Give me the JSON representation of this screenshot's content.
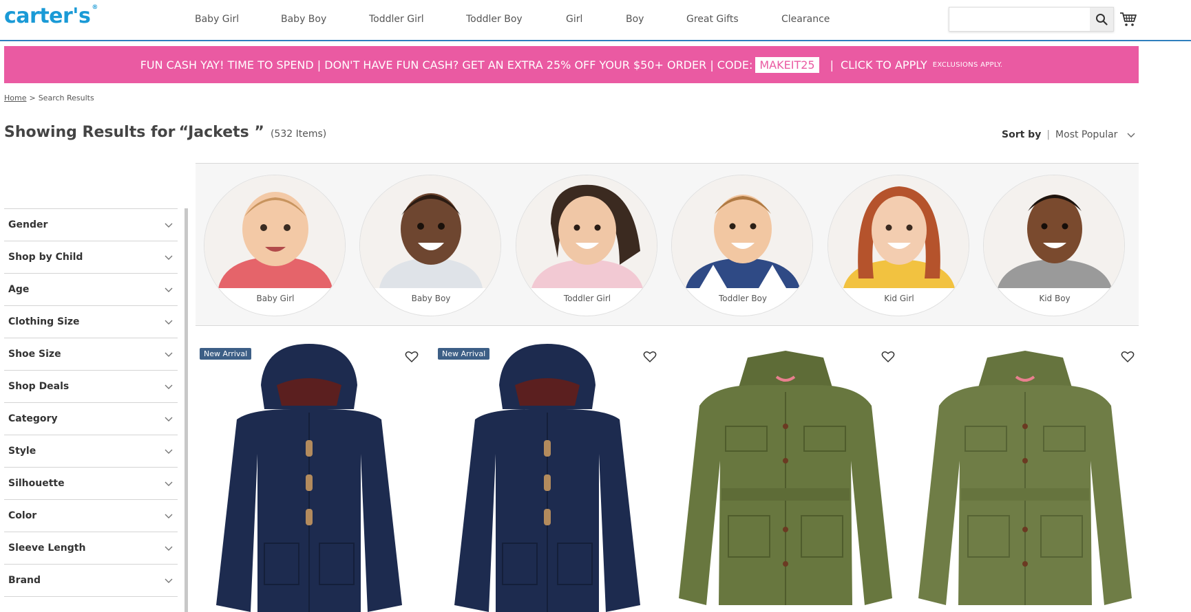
{
  "brand": {
    "logo_text": "carter's",
    "logo_mark": "®"
  },
  "nav": {
    "items": [
      {
        "label": "Baby Girl"
      },
      {
        "label": "Baby Boy"
      },
      {
        "label": "Toddler Girl"
      },
      {
        "label": "Toddler Boy"
      },
      {
        "label": "Girl"
      },
      {
        "label": "Boy"
      },
      {
        "label": "Great Gifts"
      },
      {
        "label": "Clearance"
      }
    ]
  },
  "search": {
    "value": "",
    "placeholder": "",
    "icon": "search-icon"
  },
  "cart": {
    "icon": "cart-icon"
  },
  "promo": {
    "text": "FUN CASH YAY! TIME TO SPEND | DON'T HAVE FUN CASH? GET AN EXTRA 25% OFF YOUR $50+ ORDER | CODE:",
    "code": "MAKEIT25",
    "separator": "|",
    "cta": "CLICK TO APPLY",
    "exclusions": "EXCLUSIONS APPLY.",
    "background_color": "#ea5aa2"
  },
  "breadcrumb": {
    "home": "Home",
    "chevron": ">",
    "current": "Search Results"
  },
  "results": {
    "prefix": "Showing Results for",
    "query": "“Jackets ”",
    "count": "(532 Items)"
  },
  "sort": {
    "label": "Sort by",
    "separator": "|",
    "value": "Most Popular"
  },
  "filters": [
    {
      "label": "Gender"
    },
    {
      "label": "Shop by Child"
    },
    {
      "label": "Age"
    },
    {
      "label": "Clothing Size"
    },
    {
      "label": "Shoe Size"
    },
    {
      "label": "Shop Deals"
    },
    {
      "label": "Category"
    },
    {
      "label": "Style"
    },
    {
      "label": "Silhouette"
    },
    {
      "label": "Color"
    },
    {
      "label": "Sleeve Length"
    },
    {
      "label": "Brand"
    }
  ],
  "categories": [
    {
      "label": "Baby Girl"
    },
    {
      "label": "Baby Boy"
    },
    {
      "label": "Toddler Girl"
    },
    {
      "label": "Toddler Boy"
    },
    {
      "label": "Kid Girl"
    },
    {
      "label": "Kid Boy"
    }
  ],
  "products": [
    {
      "badge": "New Arrival",
      "garment_color": "#1d2b4f"
    },
    {
      "badge": "New Arrival",
      "garment_color": "#1d2b4f"
    },
    {
      "badge": "",
      "garment_color": "#68773f"
    },
    {
      "badge": "",
      "garment_color": "#6f7d46"
    }
  ],
  "colors": {
    "accent": "#1a9ad6",
    "promo": "#ea5aa2",
    "badge": "#3d5f86"
  }
}
